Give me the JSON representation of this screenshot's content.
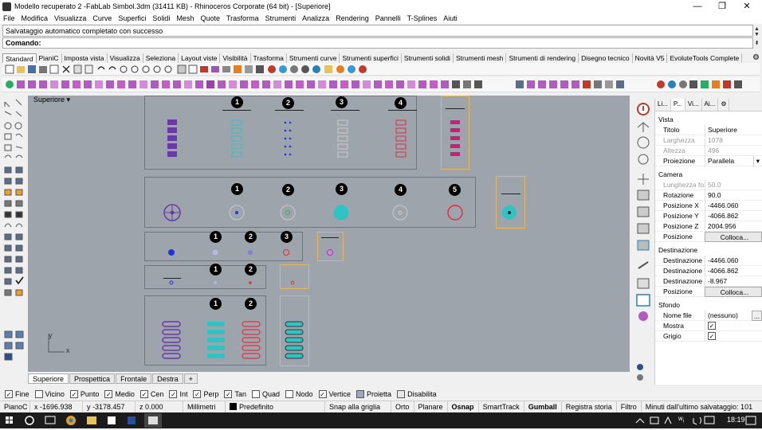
{
  "window": {
    "title": "Modello recuperato 2 -FabLab Simbol.3dm (31411 KB) - Rhinoceros Corporate (64 bit) - [Superiore]",
    "min": "—",
    "max": "❐",
    "close": "✕"
  },
  "menu": [
    "File",
    "Modifica",
    "Visualizza",
    "Curve",
    "Superfici",
    "Solidi",
    "Mesh",
    "Quote",
    "Trasforma",
    "Strumenti",
    "Analizza",
    "Rendering",
    "Pannelli",
    "T-Splines",
    "Aiuti"
  ],
  "command": {
    "history": "Salvataggio automatico completato con successo",
    "prompt": "Comando:"
  },
  "toolbar_tabs": [
    "Standard",
    "PianiC",
    "Imposta vista",
    "Visualizza",
    "Seleziona",
    "Layout viste",
    "Visibilità",
    "Trasforma",
    "Strumenti curve",
    "Strumenti superfici",
    "Strumenti solidi",
    "Strumenti mesh",
    "Strumenti di rendering",
    "Disegno tecnico",
    "Novità V5",
    "EvoluteTools Complete"
  ],
  "viewport": {
    "label": "Superiore",
    "axis_y": "y",
    "axis_x": "x"
  },
  "badges": {
    "b1": "1",
    "b2": "2",
    "b3": "3",
    "b4": "4",
    "b5": "5"
  },
  "view_tabs": [
    "Superiore",
    "Prospettica",
    "Frontale",
    "Destra"
  ],
  "view_tab_add": "+",
  "osnap": [
    {
      "label": "Fine",
      "checked": true
    },
    {
      "label": "Vicino",
      "checked": false
    },
    {
      "label": "Punto",
      "checked": true
    },
    {
      "label": "Medio",
      "checked": true
    },
    {
      "label": "Cen",
      "checked": true
    },
    {
      "label": "Int",
      "checked": true
    },
    {
      "label": "Perp",
      "checked": true
    },
    {
      "label": "Tan",
      "checked": true
    },
    {
      "label": "Quad",
      "checked": false
    },
    {
      "label": "Nodo",
      "checked": false
    },
    {
      "label": "Vertice",
      "checked": true
    },
    {
      "label": "Proietta",
      "checked": false
    },
    {
      "label": "Disabilita",
      "checked": false
    }
  ],
  "status": {
    "cplane": "PianoC",
    "x": "x -1696.938",
    "y": "y -3178.457",
    "z": "z 0.000",
    "units": "Millimetri",
    "layer": "Predefinito",
    "grid": "Snap alla griglia",
    "ortho": "Orto",
    "planar": "Planare",
    "osnap": "Osnap",
    "smarttrack": "SmartTrack",
    "gumball": "Gumball",
    "history": "Registra storia",
    "filter": "Filtro",
    "saved": "Minuti dall'ultimo salvataggio: 101"
  },
  "taskbar": {
    "time": "18:19"
  },
  "panel": {
    "tabs": [
      "Li...",
      "P...",
      "Vi...",
      "Ai..."
    ],
    "vista": "Vista",
    "titolo_k": "Titolo",
    "titolo_v": "Superiore",
    "larghezza_k": "Larghezza",
    "larghezza_v": "1078",
    "altezza_k": "Altezza",
    "altezza_v": "496",
    "proiezione_k": "Proiezione",
    "proiezione_v": "Parallela",
    "camera": "Camera",
    "lf_k": "Lunghezza fo...",
    "lf_v": "50.0",
    "rot_k": "Rotazione",
    "rot_v": "90.0",
    "px_k": "Posizione X",
    "px_v": "-4466.060",
    "py_k": "Posizione Y",
    "py_v": "-4066.862",
    "pz_k": "Posizione Z",
    "pz_v": "2004.956",
    "pos_k": "Posizione",
    "pos_btn": "Colloca...",
    "dest": "Destinazione",
    "dx_k": "Destinazione X",
    "dx_v": "-4466.060",
    "dy_k": "Destinazione Y",
    "dy_v": "-4066.862",
    "dz_k": "Destinazione Z",
    "dz_v": "-8.967",
    "dpos_k": "Posizione",
    "dpos_btn": "Colloca...",
    "sfondo": "Sfondo",
    "nf_k": "Nome file",
    "nf_v": "(nessuno)",
    "nf_btn": "...",
    "mostra_k": "Mostra",
    "grigio_k": "Grigio"
  }
}
